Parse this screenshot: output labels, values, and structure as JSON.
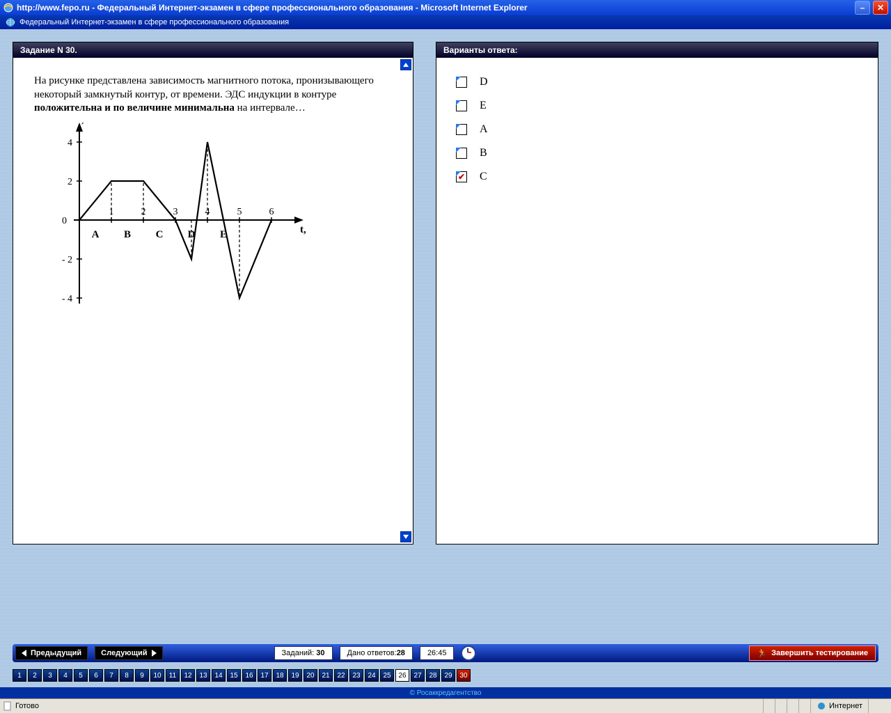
{
  "window": {
    "title": "http://www.fepo.ru - Федеральный Интернет-экзамен в сфере профессионального образования - Microsoft Internet Explorer",
    "subtitle": "Федеральный Интернет-экзамен в сфере профессионального образования"
  },
  "question_panel": {
    "title": "Задание N 30."
  },
  "question": {
    "pre": "На рисунке представлена зависимость магнитного потока, пронизывающего некоторый замкнутый контур, от времени. ЭДС индукции в контуре ",
    "bold": "положительна и по величине минимальна",
    "post": " на интервале…"
  },
  "answers_panel": {
    "title": "Варианты ответа:"
  },
  "answers": [
    {
      "label": "D",
      "checked": false
    },
    {
      "label": "E",
      "checked": false
    },
    {
      "label": "A",
      "checked": false
    },
    {
      "label": "B",
      "checked": false
    },
    {
      "label": "C",
      "checked": true
    }
  ],
  "nav": {
    "prev": "Предыдущий",
    "next": "Следующий",
    "tasks_label": "Заданий:",
    "tasks_value": "30",
    "answered_label": "Дано ответов:",
    "answered_value": "28",
    "time": "26:45",
    "finish": "Завершить тестирование"
  },
  "qnumbers": {
    "total": 30,
    "current": 26,
    "red": [
      30
    ]
  },
  "footer": {
    "copyright": "© Росаккредагентство"
  },
  "statusbar": {
    "ready": "Готово",
    "zone": "Интернет"
  },
  "chart_data": {
    "type": "line",
    "title": "",
    "xlabel": "t, с",
    "ylabel": "Ф, Вб",
    "x": [
      0,
      1,
      2,
      3,
      3.5,
      4,
      4.5,
      5,
      6
    ],
    "y": [
      0,
      2,
      2,
      0,
      -2,
      4,
      0,
      -4,
      0
    ],
    "xlim": [
      0,
      6.5
    ],
    "ylim": [
      -4,
      4
    ],
    "x_ticks": [
      1,
      2,
      3,
      4,
      5,
      6
    ],
    "y_ticks": [
      -4,
      -2,
      2,
      4
    ],
    "interval_labels": [
      {
        "label": "A",
        "x": 0.5
      },
      {
        "label": "B",
        "x": 1.5
      },
      {
        "label": "C",
        "x": 2.5
      },
      {
        "label": "D",
        "x": 3.5
      },
      {
        "label": "E",
        "x": 4.5
      }
    ],
    "dashed_verticals": [
      1,
      2,
      3.5,
      4,
      5
    ]
  }
}
